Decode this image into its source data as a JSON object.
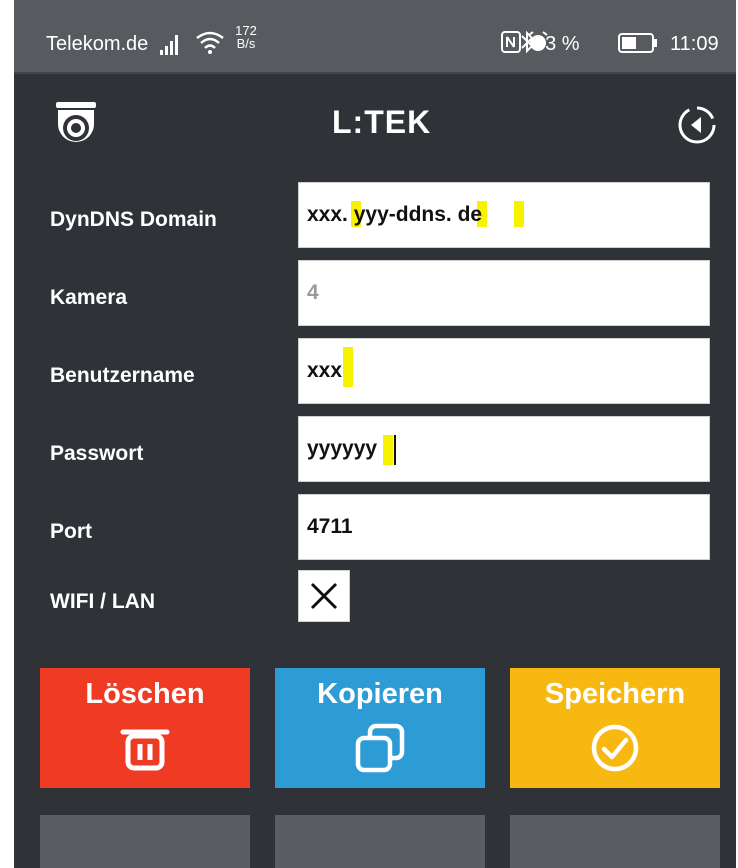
{
  "status_bar": {
    "carrier": "Telekom.de",
    "speed_value": "172",
    "speed_unit": "B/s",
    "battery_percent": "43 %",
    "time": "11:09",
    "icons": [
      "signal-icon",
      "wifi-icon",
      "nfc-icon",
      "alarm-icon",
      "bluetooth-icon",
      "battery-icon"
    ]
  },
  "app_bar": {
    "logo_text": "L:TEK",
    "left_icon": "camera-icon",
    "right_icon": "back-icon"
  },
  "form": {
    "fields": [
      {
        "label": "DynDNS Domain",
        "value": "xxx. yyy-ddns. de"
      },
      {
        "label": "Kamera",
        "value": "4",
        "placeholder": true
      },
      {
        "label": "Benutzername",
        "value": "xxx"
      },
      {
        "label": "Passwort",
        "value": "yyyyyy"
      },
      {
        "label": "Port",
        "value": "4711"
      }
    ],
    "wifi_lan": {
      "label": "WIFI / LAN",
      "checked": true
    }
  },
  "actions": [
    {
      "label": "Löschen",
      "color": "#ef3b24",
      "icon": "trash-icon"
    },
    {
      "label": "Kopieren",
      "color": "#2c9bd6",
      "icon": "copy-icon"
    },
    {
      "label": "Speichern",
      "color": "#f7b911",
      "icon": "check-circle-icon"
    }
  ],
  "colors": {
    "background": "#2f3236",
    "status_bar": "#575a5e",
    "highlight": "#f6f200",
    "secondary_button": "#5a5d61"
  }
}
